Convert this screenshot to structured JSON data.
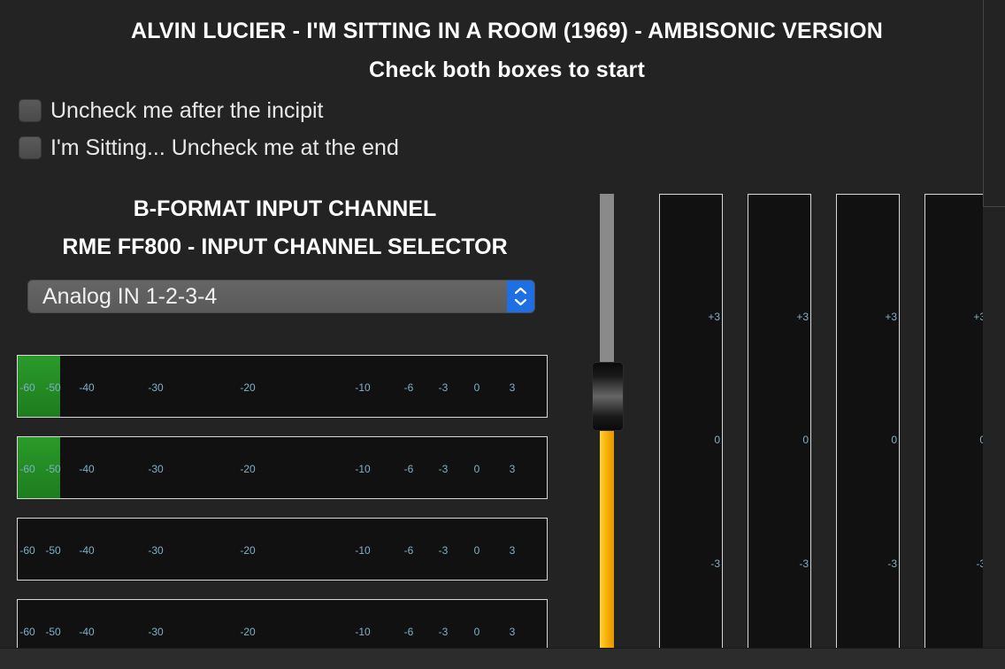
{
  "header": {
    "title": "ALVIN LUCIER - I'M SITTING IN A ROOM (1969) - AMBISONIC VERSION",
    "subtitle": "Check both boxes to start"
  },
  "checkboxes": [
    {
      "label": "Uncheck me after the incipit",
      "checked": false
    },
    {
      "label": "I'm Sitting... Uncheck me at the end",
      "checked": false
    }
  ],
  "input_section": {
    "heading": "B-FORMAT INPUT CHANNEL",
    "subheading": "RME FF800 - INPUT CHANNEL SELECTOR",
    "selector_value": "Analog IN 1-2-3-4"
  },
  "meter_scale": [
    "-60",
    "-50",
    "-40",
    "-30",
    "-20",
    "-10",
    "-6",
    "-3",
    "0",
    "3"
  ],
  "input_meters": [
    {
      "level_fraction": 0.08
    },
    {
      "level_fraction": 0.08
    },
    {
      "level_fraction": 0.0
    },
    {
      "level_fraction": 0.0
    }
  ],
  "fader": {
    "level_fraction": 0.49
  },
  "vertical_scale": [
    "+3",
    "0",
    "-3"
  ],
  "output_meters": [
    {
      "level_fraction": 0.0
    },
    {
      "level_fraction": 0.0
    },
    {
      "level_fraction": 0.0
    },
    {
      "level_fraction": 0.0
    }
  ],
  "colors": {
    "background": "#232323",
    "meter_fill": "#2a9a2a",
    "fader_fill": "#f4a800",
    "scale_text": "#7fb0c8",
    "stepper_accent": "#1e6fe3"
  }
}
